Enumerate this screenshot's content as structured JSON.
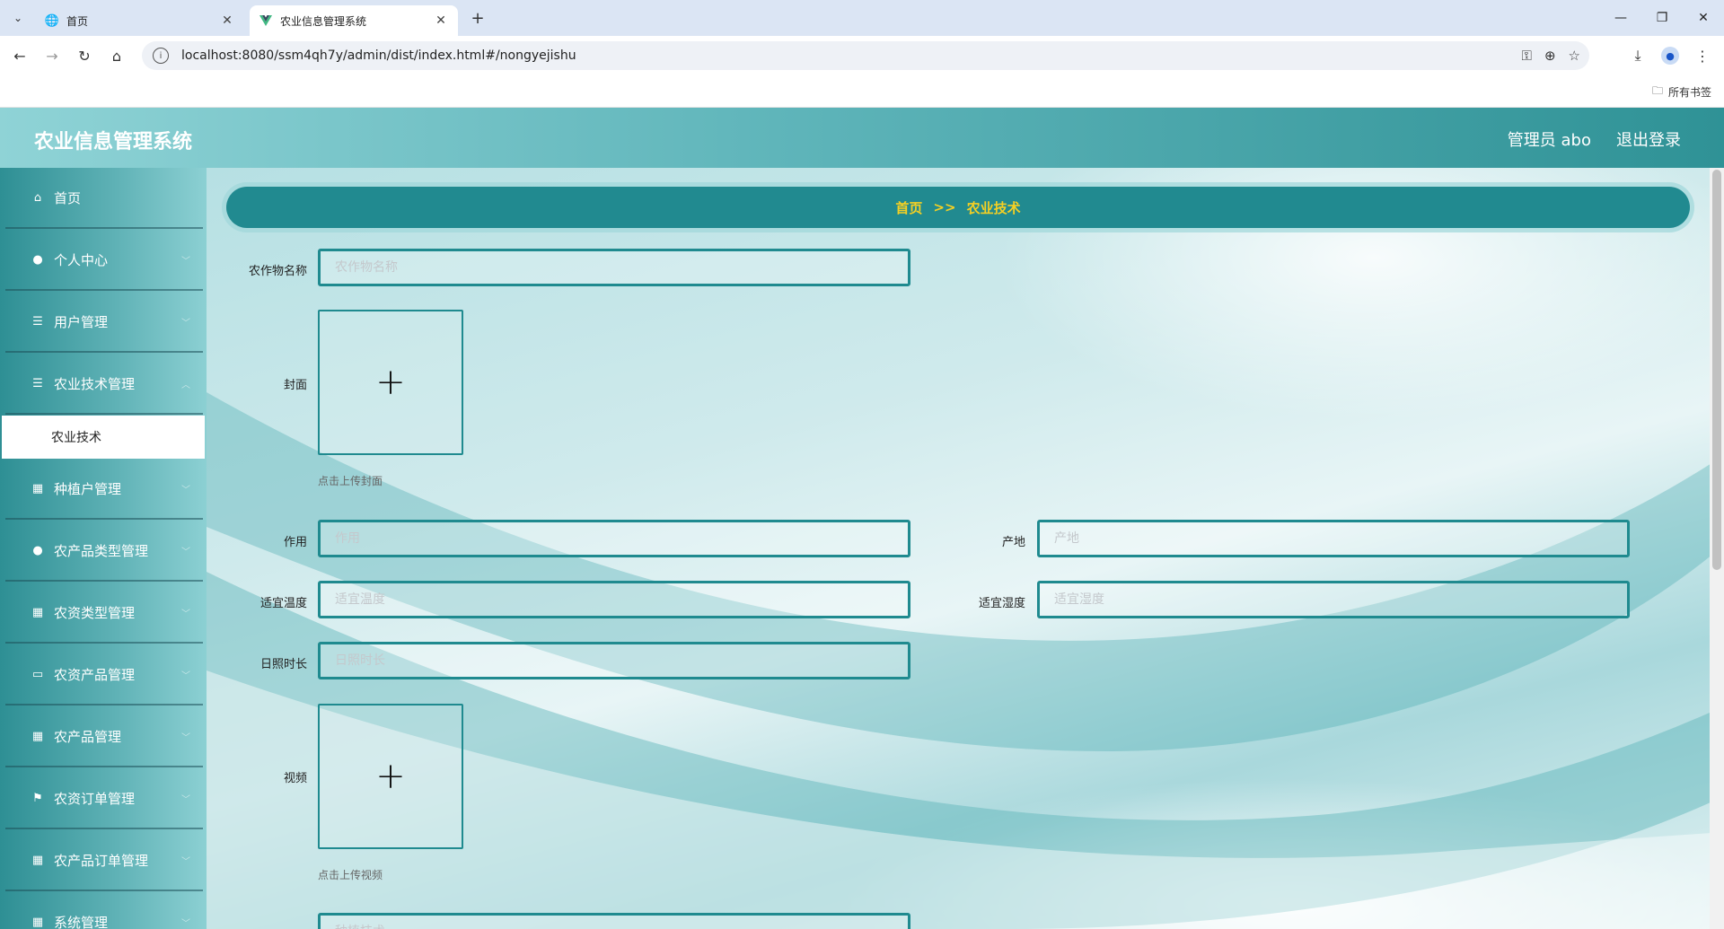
{
  "browser": {
    "tabs": [
      {
        "title": "首页",
        "icon": "globe-icon",
        "active": false
      },
      {
        "title": "农业信息管理系统",
        "icon": "vue-icon",
        "active": true
      }
    ],
    "url": "localhost:8080/ssm4qh7y/admin/dist/index.html#/nongyejishu",
    "bookmarks_label": "所有书签"
  },
  "header": {
    "title": "农业信息管理系统",
    "user": "管理员 abo",
    "logout": "退出登录"
  },
  "sidebar": {
    "items": [
      {
        "label": "首页",
        "icon": "home-icon",
        "has_arrow": false
      },
      {
        "label": "个人中心",
        "icon": "user-icon",
        "has_arrow": true
      },
      {
        "label": "用户管理",
        "icon": "list-icon",
        "has_arrow": true
      },
      {
        "label": "农业技术管理",
        "icon": "list-icon",
        "has_arrow": true
      },
      {
        "label": "种植户管理",
        "icon": "grid-icon",
        "has_arrow": true
      },
      {
        "label": "农产品类型管理",
        "icon": "user-icon",
        "has_arrow": true
      },
      {
        "label": "农资类型管理",
        "icon": "grid-icon",
        "has_arrow": true
      },
      {
        "label": "农资产品管理",
        "icon": "monitor-icon",
        "has_arrow": true
      },
      {
        "label": "农产品管理",
        "icon": "grid-icon",
        "has_arrow": true
      },
      {
        "label": "农资订单管理",
        "icon": "flag-icon",
        "has_arrow": true
      },
      {
        "label": "农产品订单管理",
        "icon": "grid-icon",
        "has_arrow": true
      },
      {
        "label": "系统管理",
        "icon": "grid-icon",
        "has_arrow": true
      }
    ],
    "active_sub": "农业技术"
  },
  "breadcrumb": {
    "home": "首页",
    "sep": ">>",
    "current": "农业技术"
  },
  "form": {
    "crop_name": {
      "label": "农作物名称",
      "placeholder": "农作物名称"
    },
    "cover": {
      "label": "封面",
      "hint": "点击上传封面"
    },
    "effect": {
      "label": "作用",
      "placeholder": "作用"
    },
    "origin": {
      "label": "产地",
      "placeholder": "产地"
    },
    "temperature": {
      "label": "适宜温度",
      "placeholder": "适宜温度"
    },
    "humidity": {
      "label": "适宜湿度",
      "placeholder": "适宜湿度"
    },
    "sunshine": {
      "label": "日照时长",
      "placeholder": "日照时长"
    },
    "video": {
      "label": "视频",
      "hint": "点击上传视频"
    },
    "next_field": {
      "placeholder": "种植技术"
    }
  },
  "colors": {
    "header_start": "#8fd3d6",
    "header_end": "#2f9296",
    "breadcrumb_bg": "#218a90",
    "breadcrumb_text": "#f5d023",
    "input_border": "#1f8a8f"
  }
}
